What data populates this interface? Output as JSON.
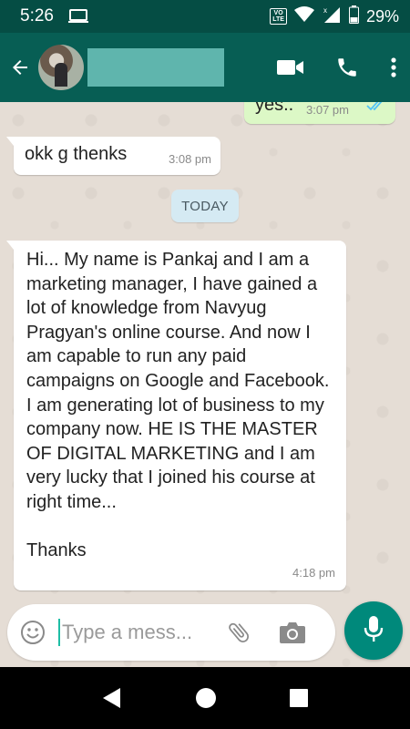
{
  "status_bar": {
    "time": "5:26",
    "volte_top": "VO",
    "volte_bottom": "LTE",
    "battery": "29%"
  },
  "app_bar": {
    "back_icon": "arrow-left-icon",
    "video_icon": "video-call-icon",
    "call_icon": "phone-icon",
    "menu_icon": "more-vert-icon"
  },
  "messages": [
    {
      "direction": "outgoing",
      "text": "yes..",
      "time": "3:07 pm",
      "status": "read"
    },
    {
      "direction": "incoming",
      "text": "okk g thenks",
      "time": "3:08 pm"
    },
    {
      "direction": "incoming",
      "text": "Hi... My name is Pankaj and I am a marketing manager, I have gained a lot of knowledge from Navyug Pragyan's online course. And now I am capable to run any paid campaigns on Google and Facebook. I am generating lot of business to my company now. HE IS THE MASTER OF DIGITAL MARKETING and I am very lucky that I joined his course at right time...\n\nThanks",
      "time": "4:18 pm"
    }
  ],
  "date_divider": "TODAY",
  "composer": {
    "placeholder": "Type a mess..."
  },
  "colors": {
    "header": "#075e54",
    "status_bar": "#054d44",
    "outgoing_bubble": "#dcf8c6",
    "incoming_bubble": "#ffffff",
    "accent": "#00897b",
    "read_ticks": "#4fc3f7"
  }
}
